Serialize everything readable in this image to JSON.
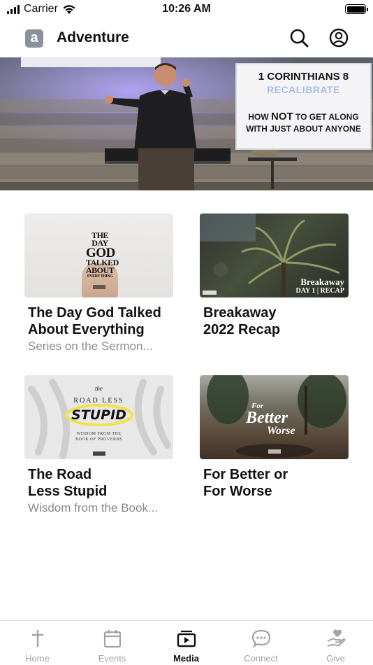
{
  "status_bar": {
    "carrier": "Carrier",
    "time": "10:26 AM"
  },
  "header": {
    "logo_letter": "a",
    "title": "Adventure"
  },
  "hero": {
    "slide_line1": "1 CORINTHIANS 8",
    "slide_line2": "RECALIBRATE",
    "slide_line3_pre": "HOW ",
    "slide_line3_bold": "NOT",
    "slide_line3_post": " TO GET ALONG",
    "slide_line4": "WITH JUST ABOUT ANYONE"
  },
  "cards": [
    {
      "title": "The Day God Talked\nAbout Everything",
      "subtitle": "Series on the Sermon...",
      "thumb_text": [
        "THE DAY",
        "GOD",
        "TALKED",
        "ABOUT",
        "EVERY THING"
      ]
    },
    {
      "title": "Breakaway\n2022 Recap",
      "subtitle": "",
      "thumb_text": [
        "Breakaway",
        "DAY 1 | RECAP"
      ]
    },
    {
      "title": "The Road\nLess Stupid",
      "subtitle": "Wisdom from the Book...",
      "thumb_text": [
        "the",
        "ROAD LESS",
        "STUPID",
        "WISDOM FROM THE",
        "BOOK OF PROVERBS"
      ]
    },
    {
      "title": "For Better or\nFor Worse",
      "subtitle": "",
      "thumb_text": [
        "For",
        "Better",
        "Worse"
      ]
    }
  ],
  "tabs": [
    {
      "label": "Home",
      "icon": "cross-icon",
      "active": false
    },
    {
      "label": "Events",
      "icon": "calendar-icon",
      "active": false
    },
    {
      "label": "Media",
      "icon": "media-icon",
      "active": true
    },
    {
      "label": "Connect",
      "icon": "chat-icon",
      "active": false
    },
    {
      "label": "Give",
      "icon": "hand-heart-icon",
      "active": false
    }
  ],
  "colors": {
    "active_tab": "#111111",
    "inactive_tab": "#a3a3a3",
    "subtitle": "#8b8b8b"
  }
}
